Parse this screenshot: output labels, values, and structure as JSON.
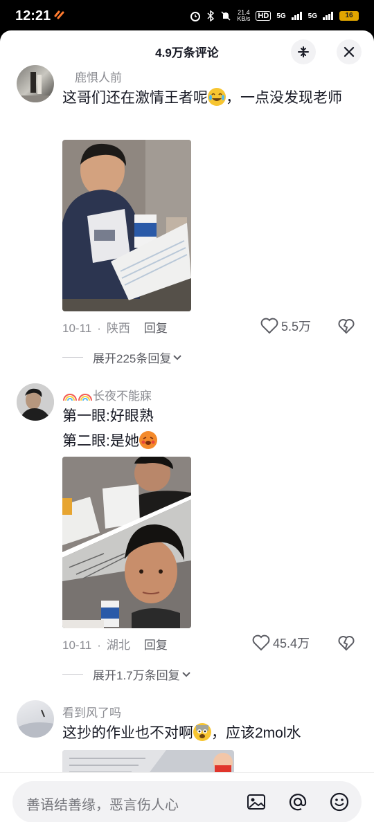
{
  "status": {
    "time": "12:21",
    "net_speed": "21.4\nKB/s",
    "hd": "HD",
    "sig1": "5G",
    "sig2": "5G",
    "battery": "16"
  },
  "header": {
    "title": "4.9万条评论"
  },
  "comments": [
    {
      "username": "鹿惧人前",
      "text_before": "这哥们还在激情王者呢",
      "text_after": "，一点没发现老师",
      "date": "10-11",
      "location": "陕西",
      "reply": "回复",
      "likes": "5.5万",
      "expand": "展开225条回复"
    },
    {
      "username": "长夜不能寐",
      "line1": "第一眼:好眼熟",
      "line2": "第二眼:是她",
      "date": "10-11",
      "location": "湖北",
      "reply": "回复",
      "likes": "45.4万",
      "expand": "展开1.7万条回复"
    },
    {
      "username": "看到风了吗",
      "text_before": "这抄的作业也不对啊",
      "text_after": "，应该2mol水"
    }
  ],
  "input": {
    "placeholder": "善语结善缘，恶言伤人心"
  },
  "colors": {
    "primary_text": "#161823",
    "secondary_text": "#8a8b91",
    "background": "#ffffff",
    "input_bg": "#f2f2f4"
  }
}
